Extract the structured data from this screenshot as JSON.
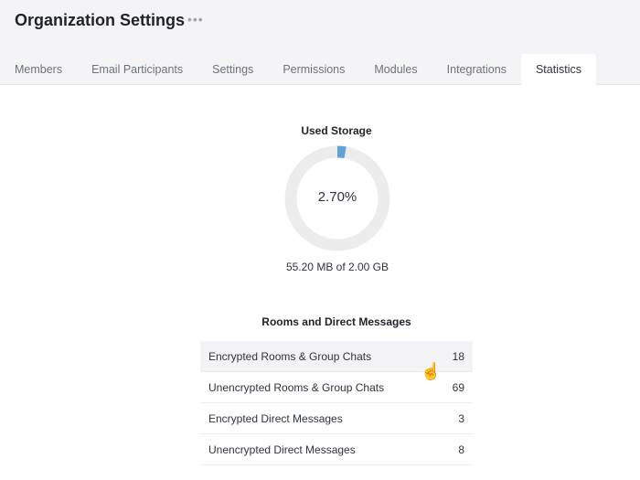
{
  "header": {
    "title": "Organization Settings",
    "more_icon": "ellipsis-icon"
  },
  "tabs": [
    {
      "label": "Members"
    },
    {
      "label": "Email Participants"
    },
    {
      "label": "Settings"
    },
    {
      "label": "Permissions"
    },
    {
      "label": "Modules"
    },
    {
      "label": "Integrations"
    },
    {
      "label": "Statistics",
      "active": true
    }
  ],
  "storage": {
    "title": "Used Storage",
    "percent_label": "2.70%",
    "percent": 2.7,
    "detail": "55.20 MB of 2.00 GB",
    "colors": {
      "used": "#5fa3da",
      "track": "#ececec"
    }
  },
  "rooms": {
    "title": "Rooms and Direct Messages",
    "rows": [
      {
        "label": "Encrypted Rooms & Group Chats",
        "value": "18"
      },
      {
        "label": "Unencrypted Rooms & Group Chats",
        "value": "69"
      },
      {
        "label": "Encrypted Direct Messages",
        "value": "3"
      },
      {
        "label": "Unencrypted Direct Messages",
        "value": "8"
      }
    ]
  }
}
